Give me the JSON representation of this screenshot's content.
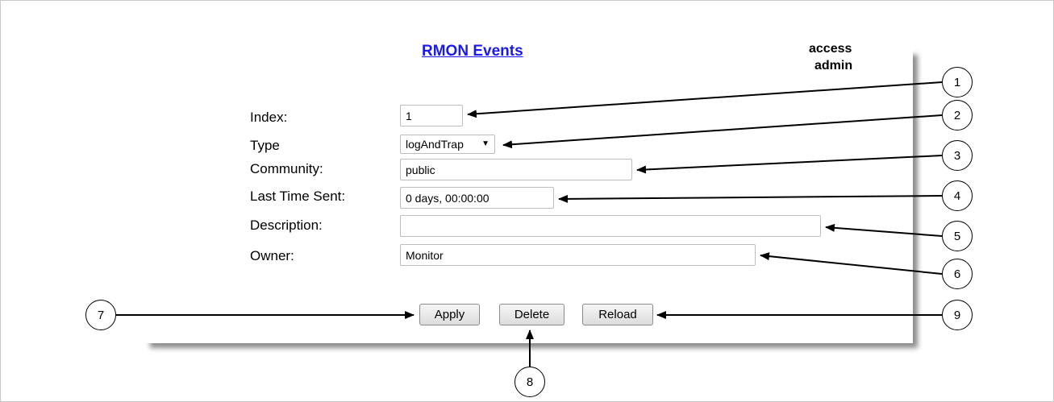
{
  "page": {
    "title": "RMON Events",
    "access_label": "access",
    "access_value": "admin"
  },
  "form": {
    "index": {
      "label": "Index:",
      "value": "1"
    },
    "type": {
      "label": "Type",
      "value": "logAndTrap"
    },
    "community": {
      "label": "Community:",
      "value": "public"
    },
    "last_time_sent": {
      "label": "Last Time Sent:",
      "value": "0 days, 00:00:00"
    },
    "description": {
      "label": "Description:",
      "value": ""
    },
    "owner": {
      "label": "Owner:",
      "value": "Monitor"
    }
  },
  "buttons": {
    "apply": "Apply",
    "delete": "Delete",
    "reload": "Reload"
  },
  "callouts": [
    "1",
    "2",
    "3",
    "4",
    "5",
    "6",
    "7",
    "8",
    "9"
  ]
}
